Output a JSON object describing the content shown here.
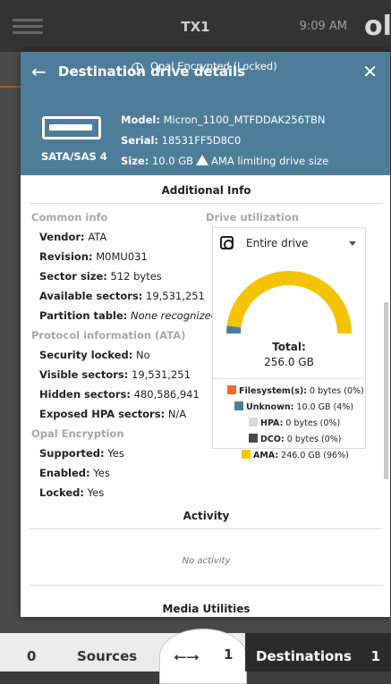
{
  "topbar": {
    "title": "TX1",
    "time": "9:09 AM",
    "logo": "ol"
  },
  "modal": {
    "title": "Destination drive details",
    "drive_type": "SATA/SAS 4",
    "status": "Opal Encrypted (Locked)",
    "model_label": "Model:",
    "model": "Micron_1100_MTFDDAK256TBN",
    "serial_label": "Serial:",
    "serial": "18531FF5D8C0",
    "size_label": "Size:",
    "size": "10.0 GB",
    "size_note": "AMA limiting drive size"
  },
  "additional": {
    "title": "Additional Info",
    "common_heading": "Common info",
    "common": [
      {
        "label": "Vendor:",
        "value": "ATA"
      },
      {
        "label": "Revision:",
        "value": "M0MU031"
      },
      {
        "label": "Sector size:",
        "value": "512 bytes"
      },
      {
        "label": "Available sectors:",
        "value": "19,531,251"
      },
      {
        "label": "Partition table:",
        "value": "None recognized"
      }
    ],
    "protocol_heading": "Protocol information (ATA)",
    "protocol": [
      {
        "label": "Security locked:",
        "value": "No"
      },
      {
        "label": "Visible sectors:",
        "value": "19,531,251"
      },
      {
        "label": "Hidden sectors:",
        "value": "480,586,941"
      },
      {
        "label": "Exposed HPA sectors:",
        "value": "N/A"
      }
    ],
    "opal_heading": "Opal Encryption",
    "opal": [
      {
        "label": "Supported:",
        "value": "Yes"
      },
      {
        "label": "Enabled:",
        "value": "Yes"
      },
      {
        "label": "Locked:",
        "value": "Yes"
      }
    ]
  },
  "utilization": {
    "heading": "Drive utilization",
    "dropdown_value": "Entire drive",
    "total_label": "Total:",
    "total_value": "256.0 GB",
    "legend": [
      {
        "label": "Filesystem(s):",
        "value": "0 bytes (0%)",
        "color": "#f26b22",
        "fraction": 0.0
      },
      {
        "label": "Unknown:",
        "value": "10.0 GB (4%)",
        "color": "#4e7d9a",
        "fraction": 0.04
      },
      {
        "label": "HPA:",
        "value": "0 bytes (0%)",
        "color": "#d9d9d9",
        "fraction": 0.0
      },
      {
        "label": "DCO:",
        "value": "0 bytes (0%)",
        "color": "#4a4a4a",
        "fraction": 0.0
      },
      {
        "label": "AMA:",
        "value": "246.0 GB (96%)",
        "color": "#f5c400",
        "fraction": 0.96
      }
    ]
  },
  "activity": {
    "title": "Activity",
    "empty": "No activity"
  },
  "media": {
    "title": "Media Utilities"
  },
  "bottom": {
    "left_count": "0",
    "sources_label": "Sources",
    "center_count": "1",
    "destinations_label": "Destinations",
    "destinations_count": "1"
  }
}
